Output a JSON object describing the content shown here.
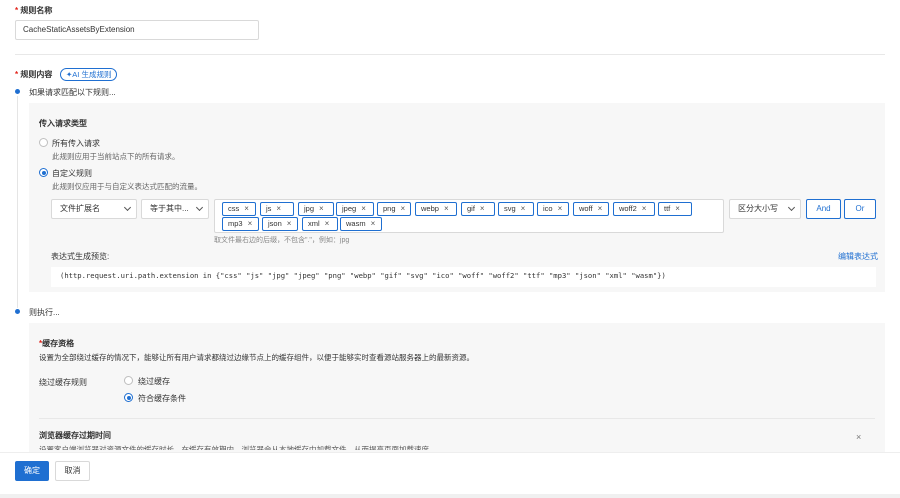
{
  "rule_name": {
    "label": "规则名称",
    "value": "CacheStaticAssetsByExtension"
  },
  "rule_content": {
    "label": "规则内容",
    "ai_button": "AI 生成规则",
    "if_step": "如果请求匹配以下规则...",
    "then_step": "则执行..."
  },
  "incoming": {
    "title": "传入请求类型",
    "all_label": "所有传入请求",
    "all_desc": "此规则应用于当前站点下的所有请求。",
    "custom_label": "自定义规则",
    "custom_desc": "此规则仅应用于与自定义表达式匹配的流量。",
    "selected": "custom"
  },
  "condition": {
    "field": "文件扩展名",
    "operator": "等于其中...",
    "tags": [
      "css",
      "js",
      "jpg",
      "jpeg",
      "png",
      "webp",
      "gif",
      "svg",
      "ico",
      "woff",
      "woff2",
      "ttf",
      "mp3",
      "json",
      "xml",
      "wasm"
    ],
    "hint": "取文件最右边的后缀，不包含\".\"，例如：jpg",
    "case": "区分大小写",
    "and_label": "And",
    "or_label": "Or"
  },
  "expression": {
    "label": "表达式生成预览:",
    "edit_link": "编辑表达式",
    "text": "(http.request.uri.path.extension in {\"css\" \"js\" \"jpg\" \"jpeg\" \"png\" \"webp\" \"gif\" \"svg\" \"ico\" \"woff\" \"woff2\" \"ttf\" \"mp3\" \"json\" \"xml\" \"wasm\"})"
  },
  "cache": {
    "title": "缓存资格",
    "desc": "设置为全部绕过缓存的情况下，能够让所有用户请求都绕过边缘节点上的缓存组件，以便于能够实时查看源站服务器上的最新资源。",
    "bypass_rule_label": "绕过缓存规则",
    "opt_bypass": "绕过缓存",
    "opt_eligible": "符合缓存条件",
    "selected": "eligible"
  },
  "browser_ttl": {
    "title": "浏览器缓存过期时间",
    "desc": "设置客户端浏览器对资源文件的缓存时长，在缓存有效期内，浏览器会从本地缓存中加载文件，从而提高页面加载速度。"
  },
  "footer": {
    "confirm": "确定",
    "cancel": "取消"
  }
}
